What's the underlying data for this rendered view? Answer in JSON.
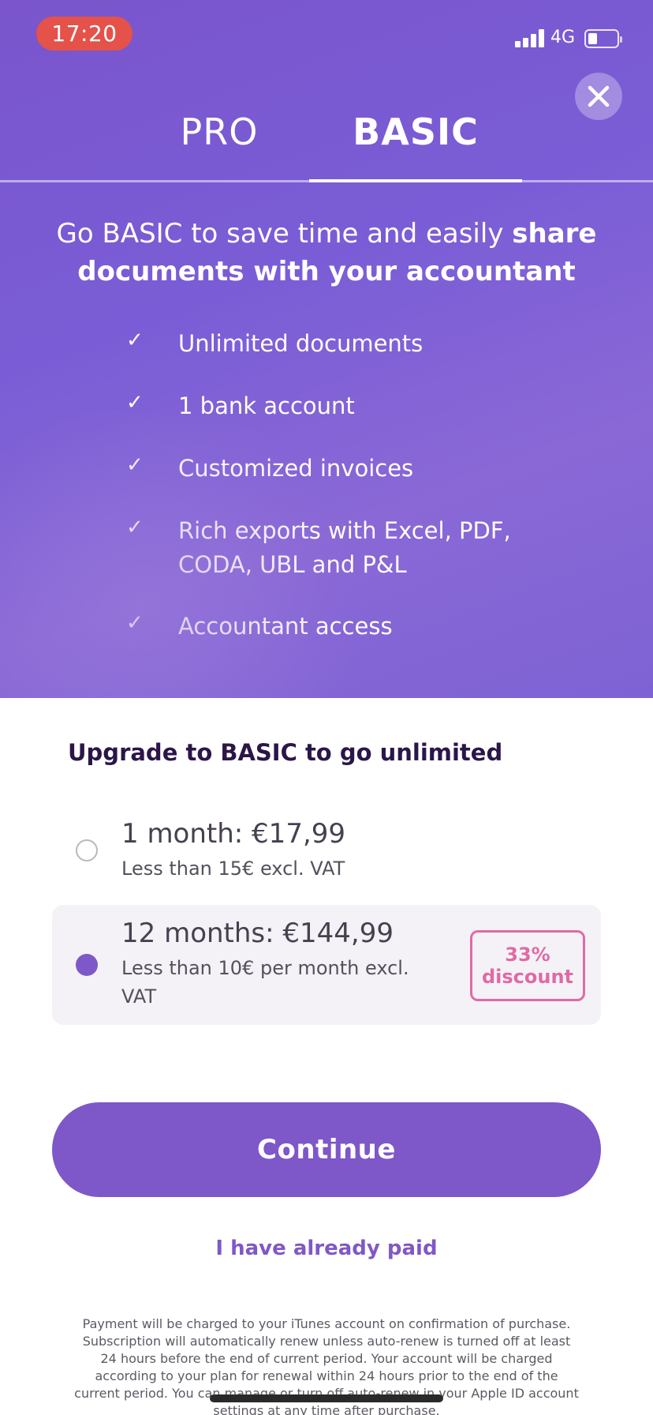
{
  "status_bar": {
    "time": "17:20",
    "network": "4G",
    "icons": [
      "signal-icon",
      "battery-icon"
    ]
  },
  "close_icon": "close-icon",
  "tabs": [
    {
      "label": "PRO",
      "active": false
    },
    {
      "label": "BASIC",
      "active": true
    }
  ],
  "headline": {
    "normal": "Go BASIC to save time and easily ",
    "bold": "share documents with your accountant"
  },
  "features": [
    {
      "icon": "check-icon",
      "label": "Unlimited documents"
    },
    {
      "icon": "check-icon",
      "label": "1 bank account"
    },
    {
      "icon": "check-icon",
      "label": "Customized invoices"
    },
    {
      "icon": "check-icon",
      "label": "Rich exports with Excel, PDF, CODA, UBL and P&L"
    },
    {
      "icon": "check-icon",
      "label": "Accountant access"
    }
  ],
  "check_glyph": "✓",
  "section_title": "Upgrade to BASIC to go unlimited",
  "plans": [
    {
      "title": "1 month: €17,99",
      "subtitle": "Less than 15€ excl. VAT",
      "selected": false
    },
    {
      "title": "12 months: €144,99",
      "subtitle": "Less than 10€ per month excl. VAT",
      "selected": true,
      "badge_line1": "33%",
      "badge_line2": "discount"
    }
  ],
  "continue_label": "Continue",
  "paid_link": "I have already paid",
  "legal_text": "Payment will be charged to your iTunes account on confirmation of purchase. Subscription will automatically renew unless auto-renew is turned off at least 24 hours before the end of current period. Your account will be charged according to your plan for renewal within 24 hours prior to the end of the current period. You can manage or turn off auto-renew in your Apple ID account settings at any time after purchase.",
  "colors": {
    "accent": "#7e57c8",
    "discount": "#e06aa6",
    "time_pill": "#e4524a"
  }
}
